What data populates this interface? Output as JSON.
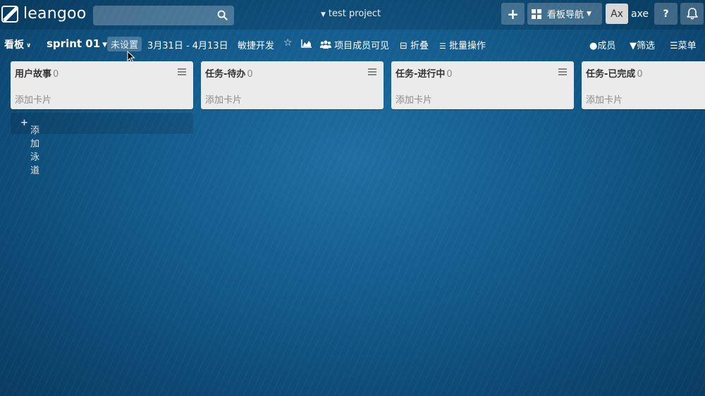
{
  "header": {
    "logo_text": "leangoo",
    "search_placeholder": "",
    "project_title": "test project",
    "add_label": "+",
    "board_nav_label": "看板导航",
    "avatar_initials": "Ax",
    "username": "axe",
    "help_label": "?"
  },
  "toolbar": {
    "board_label": "看板",
    "sprint_label": "sprint 01",
    "unset_label": "未设置",
    "date_range": "3月31日 - 4月13日",
    "agile_label": "敏捷开发",
    "members_visible_label": "项目成员可见",
    "fold_label": "折叠",
    "batch_label": "批量操作",
    "member_label": "成员",
    "filter_label": "筛选",
    "menu_label": "菜单"
  },
  "lists": [
    {
      "title": "用户故事",
      "count": "0",
      "add_card": "添加卡片"
    },
    {
      "title": "任务-待办",
      "count": "0",
      "add_card": "添加卡片"
    },
    {
      "title": "任务-进行中",
      "count": "0",
      "add_card": "添加卡片"
    },
    {
      "title": "任务-已完成",
      "count": "0",
      "add_card": "添加卡片"
    }
  ],
  "add_lane_label": "添加泳道",
  "colors": {
    "background": "#135a8a",
    "list_bg": "#ebebeb",
    "avatar_bg": "#d8d8d8"
  }
}
